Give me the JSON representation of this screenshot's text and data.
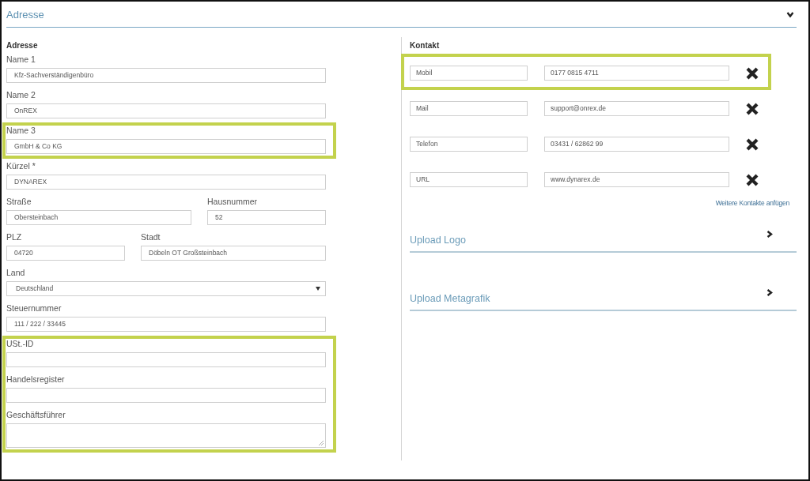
{
  "section": {
    "title": "Adresse",
    "expanded": true
  },
  "address": {
    "heading": "Adresse",
    "rows": [
      {
        "highlighted": false,
        "fields": [
          {
            "kind": "text",
            "label": "Name 1",
            "value": "Kfz-Sachverständigenbüro"
          }
        ]
      },
      {
        "highlighted": false,
        "fields": [
          {
            "kind": "text",
            "label": "Name 2",
            "value": "OnREX"
          }
        ]
      },
      {
        "highlighted": true,
        "fields": [
          {
            "kind": "text",
            "label": "Name 3",
            "value": "GmbH & Co KG"
          }
        ]
      },
      {
        "highlighted": false,
        "fields": [
          {
            "kind": "text",
            "label": "Kürzel *",
            "value": "DYNAREX"
          }
        ]
      },
      {
        "highlighted": false,
        "fields": [
          {
            "kind": "text",
            "label": "Straße",
            "value": "Obersteinbach"
          },
          {
            "kind": "short",
            "label": "Hausnummer",
            "value": "52"
          }
        ]
      },
      {
        "highlighted": false,
        "fields": [
          {
            "kind": "short",
            "label": "PLZ",
            "value": "04720"
          },
          {
            "kind": "text",
            "label": "Stadt",
            "value": "Döbeln OT Großsteinbach"
          }
        ]
      },
      {
        "highlighted": false,
        "fields": [
          {
            "kind": "select",
            "label": "Land",
            "value": "Deutschland"
          }
        ]
      },
      {
        "highlighted": false,
        "fields": [
          {
            "kind": "text",
            "label": "Steuernummer",
            "value": "111 / 222 / 33445"
          }
        ]
      },
      {
        "highlighted": true,
        "fields": [
          {
            "kind": "text",
            "label": "USt.-ID"
          }
        ]
      },
      {
        "highlighted": true,
        "fields": [
          {
            "kind": "text",
            "label": "Handelsregister"
          }
        ]
      },
      {
        "highlighted": true,
        "fields": [
          {
            "kind": "textarea",
            "label": "Geschäftsführer"
          }
        ]
      }
    ]
  },
  "contact": {
    "heading": "Kontakt",
    "items": [
      {
        "type": "Mobil",
        "value": "0177 0815 4711",
        "highlighted": true
      },
      {
        "type": "Mail",
        "value": "support@onrex.de",
        "highlighted": false
      },
      {
        "type": "Telefon",
        "value": "03431 / 62862 99",
        "highlighted": false
      },
      {
        "type": "URL",
        "value": "www.dynarex.de",
        "highlighted": false
      }
    ],
    "add_link": "Weitere Kontakte anfügen"
  },
  "uploads": [
    {
      "title": "Upload Logo",
      "expanded": false
    },
    {
      "title": "Upload Metagrafik",
      "expanded": false
    }
  ]
}
